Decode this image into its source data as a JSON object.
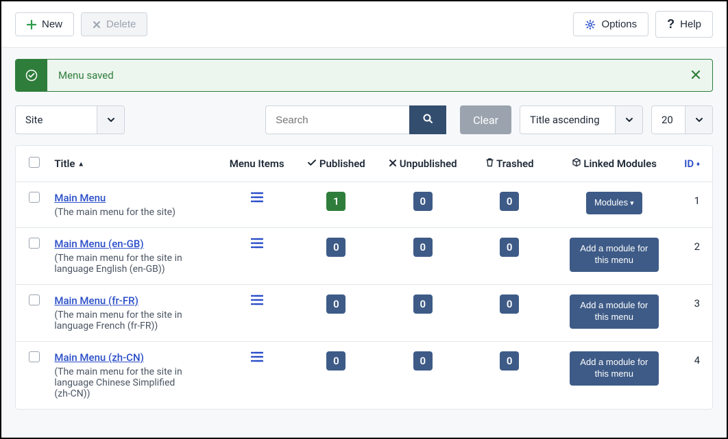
{
  "toolbar": {
    "new_label": "New",
    "delete_label": "Delete",
    "options_label": "Options",
    "help_label": "Help"
  },
  "alert": {
    "message": "Menu saved"
  },
  "filters": {
    "site_label": "Site",
    "search_placeholder": "Search",
    "clear_label": "Clear",
    "sort_label": "Title ascending",
    "limit_label": "20"
  },
  "columns": {
    "title": "Title",
    "items": "Menu Items",
    "published": "Published",
    "unpublished": "Unpublished",
    "trashed": "Trashed",
    "modules": "Linked Modules",
    "id": "ID"
  },
  "module_labels": {
    "dropdown": "Modules",
    "add": "Add a module for this menu"
  },
  "rows": [
    {
      "title": "Main Menu",
      "desc": "(The main menu for the site)",
      "published": "1",
      "published_green": true,
      "unpublished": "0",
      "trashed": "0",
      "module_type": "dropdown",
      "id": "1"
    },
    {
      "title": "Main Menu (en-GB)",
      "desc": "(The main menu for the site in language English (en-GB))",
      "published": "0",
      "published_green": false,
      "unpublished": "0",
      "trashed": "0",
      "module_type": "add",
      "id": "2"
    },
    {
      "title": "Main Menu (fr-FR)",
      "desc": "(The main menu for the site in language French (fr-FR))",
      "published": "0",
      "published_green": false,
      "unpublished": "0",
      "trashed": "0",
      "module_type": "add",
      "id": "3"
    },
    {
      "title": "Main Menu (zh-CN)",
      "desc": "(The main menu for the site in language Chinese Simplified (zh-CN))",
      "published": "0",
      "published_green": false,
      "unpublished": "0",
      "trashed": "0",
      "module_type": "add",
      "id": "4"
    }
  ]
}
